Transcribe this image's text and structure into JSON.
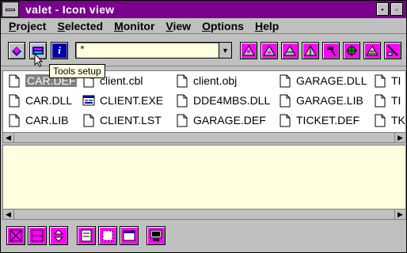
{
  "window": {
    "title": "valet - Icon view"
  },
  "menu": [
    {
      "label": "Project",
      "ul": "P",
      "rest": "roject"
    },
    {
      "label": "Selected",
      "ul": "S",
      "rest": "elected"
    },
    {
      "label": "Monitor",
      "ul": "M",
      "rest": "onitor"
    },
    {
      "label": "View",
      "ul": "V",
      "rest": "iew"
    },
    {
      "label": "Options",
      "ul": "O",
      "rest": "ptions"
    },
    {
      "label": "Help",
      "ul": "H",
      "rest": "elp"
    }
  ],
  "toolbar": {
    "filter_value": "*",
    "tooltip": "Tools setup"
  },
  "files": [
    {
      "name": "CAR.DEF",
      "icon": "document-icon",
      "selected": true
    },
    {
      "name": "client.cbl",
      "icon": "document-icon"
    },
    {
      "name": "client.obj",
      "icon": "document-icon"
    },
    {
      "name": "GARAGE.DLL",
      "icon": "document-icon"
    },
    {
      "name": "TI",
      "icon": "document-icon"
    },
    {
      "name": "CAR.DLL",
      "icon": "document-icon"
    },
    {
      "name": "CLIENT.EXE",
      "icon": "executable-icon"
    },
    {
      "name": "DDE4MBS.DLL",
      "icon": "document-icon"
    },
    {
      "name": "GARAGE.LIB",
      "icon": "document-icon"
    },
    {
      "name": "TI",
      "icon": "document-icon"
    },
    {
      "name": "CAR.LIB",
      "icon": "document-icon"
    },
    {
      "name": "CLIENT.LST",
      "icon": "document-icon"
    },
    {
      "name": "GARAGE.DEF",
      "icon": "document-icon"
    },
    {
      "name": "TICKET.DEF",
      "icon": "document-icon"
    },
    {
      "name": "TK",
      "icon": "document-icon"
    }
  ],
  "colors": {
    "title_bar": "#7a008e",
    "accent": "#ff00ff",
    "log_background": "#ffffe0"
  }
}
